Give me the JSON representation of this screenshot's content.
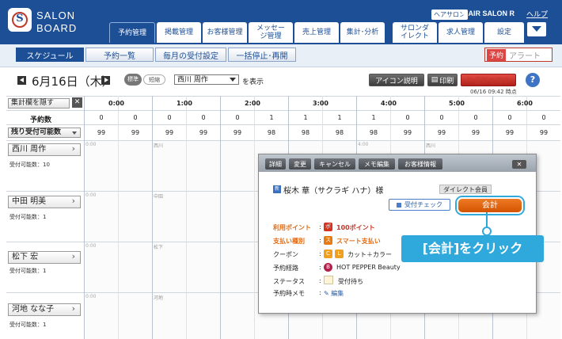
{
  "header": {
    "logo_line1": "SALON",
    "logo_line2": "BOARD",
    "logo_letter": "S",
    "salon_tag": "ヘアサロン",
    "salon_name": "HAIR SALON R",
    "help": "ヘルプ",
    "tabs": [
      "予約管理",
      "掲載管理",
      "お客様管理",
      "メッセージ管理",
      "売上管理",
      "集計･分析",
      "サロンダイレクト",
      "求人管理",
      "設定"
    ]
  },
  "subnav": {
    "items": [
      "スケジュール",
      "予約一覧",
      "毎月の受付設定",
      "一括停止･再開"
    ],
    "alert_tag": "予約",
    "alert_label": "アラート"
  },
  "toolbar": {
    "date": "6月16日（木）",
    "toggle_standard": "標準",
    "toggle_short": "短縮",
    "staff": "西川 周作",
    "display": "を表示",
    "icon_help": "アイコン説明",
    "print": "印刷",
    "refresh": "最新を表示",
    "help": "?",
    "updated": "06/16 09:42 時点"
  },
  "grid": {
    "hide_totals": "集計欄を隠す",
    "close": "✕",
    "bookings_label": "予約数",
    "remaining_label": "残り受付可能数",
    "hours": [
      "0:00",
      "1:00",
      "2:00",
      "3:00",
      "4:00",
      "5:00",
      "6:00"
    ],
    "bookings": [
      "0",
      "0",
      "0",
      "0",
      "0",
      "1",
      "1",
      "1",
      "1",
      "0",
      "0",
      "0",
      "0",
      "0"
    ],
    "remaining": [
      "99",
      "99",
      "99",
      "99",
      "99",
      "98",
      "98",
      "98",
      "98",
      "99",
      "99",
      "99",
      "99",
      "99"
    ],
    "staff": [
      {
        "name": "西川 周作",
        "capacity": "受付可能数：10",
        "tag": "西川"
      },
      {
        "name": "中田 明美",
        "capacity": "受付可能数：1",
        "tag": "中田"
      },
      {
        "name": "松下 宏",
        "capacity": "受付可能数：1",
        "tag": "松下"
      },
      {
        "name": "河地 なな子",
        "capacity": "受付可能数：1",
        "tag": "河地"
      }
    ]
  },
  "popup": {
    "buttons": [
      "詳細",
      "変更",
      "キャンセル",
      "メモ編集",
      "お客様情報"
    ],
    "close": "✕",
    "new_badge": "新",
    "customer": "桜木 華（サクラギ ハナ）様",
    "direct_member": "ダイレクト会員",
    "checkin": "受付チェック",
    "pay": "会計",
    "rows": {
      "points_label": "利用ポイント",
      "points_icon": "ポ",
      "points_value": "100ポイント",
      "payment_label": "支払い種別",
      "payment_icon": "ス",
      "payment_value": "スマート支払い",
      "coupon_label": "クーポン",
      "coupon_icon1": "C",
      "coupon_icon2": "L",
      "coupon_value": "カット＋カラー",
      "route_label": "予約経路",
      "route_icon": "B",
      "route_value": "HOT PEPPER Beauty",
      "status_label": "ステータス",
      "status_value": "受付待ち",
      "memo_label": "予約時メモ",
      "memo_value": "✎ 編集"
    }
  },
  "callout": "[会計]をクリック"
}
